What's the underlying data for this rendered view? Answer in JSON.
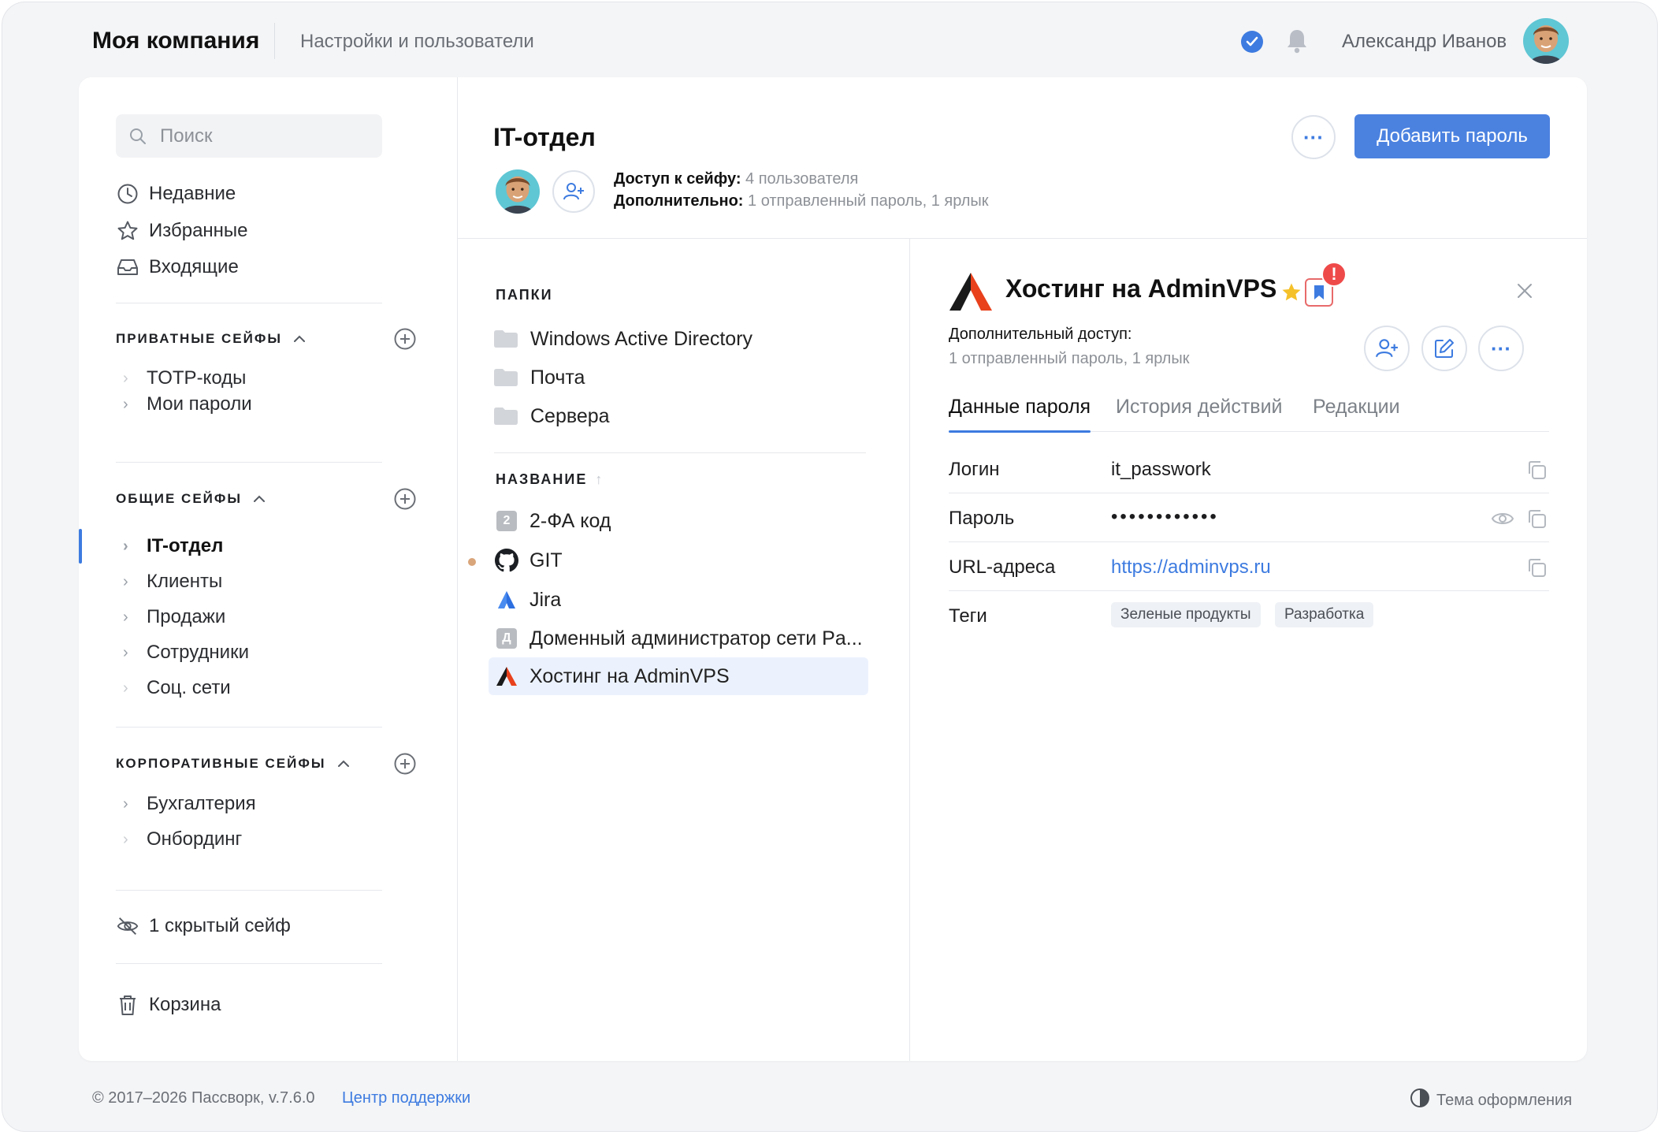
{
  "header": {
    "brand": "Моя компания",
    "nav_link": "Настройки и пользователи",
    "user_name": "Александр Иванов"
  },
  "sidebar": {
    "search_placeholder": "Поиск",
    "quick": [
      {
        "label": "Недавние",
        "icon": "clock-icon"
      },
      {
        "label": "Избранные",
        "icon": "star-icon"
      },
      {
        "label": "Входящие",
        "icon": "inbox-icon"
      }
    ],
    "sections": [
      {
        "title": "ПРИВАТНЫЕ СЕЙФЫ",
        "items": [
          "TOTP-коды",
          "Мои пароли"
        ]
      },
      {
        "title": "ОБЩИЕ СЕЙФЫ",
        "items": [
          "IT-отдел",
          "Клиенты",
          "Продажи",
          "Сотрудники",
          "Соц. сети"
        ]
      },
      {
        "title": "КОРПОРАТИВНЫЕ СЕЙФЫ",
        "items": [
          "Бухгалтерия",
          "Онбординг"
        ]
      }
    ],
    "hidden_vaults": "1 скрытый сейф",
    "trash": "Корзина"
  },
  "vault": {
    "title": "IT-отдел",
    "access_label": "Доступ к сейфу:",
    "access_value": "4 пользователя",
    "extra_label": "Дополнительно:",
    "extra_value": "1 отправленный пароль, 1 ярлык",
    "more_label": "···",
    "add_button": "Добавить пароль"
  },
  "list": {
    "folders_header": "ПАПКИ",
    "folders": [
      "Windows Active Directory",
      "Почта",
      "Сервера"
    ],
    "name_header": "НАЗВАНИЕ",
    "sort_arrow": "↑",
    "items": [
      {
        "name": "2-ФА код",
        "icon_letter": "2"
      },
      {
        "name": "GIT",
        "icon": "github-icon"
      },
      {
        "name": "Jira",
        "icon": "jira-icon"
      },
      {
        "name": "Доменный администратор сети Pa...",
        "icon_letter": "Д"
      },
      {
        "name": "Хостинг на AdminVPS",
        "icon": "adminvps-icon"
      }
    ]
  },
  "detail": {
    "title": "Хостинг на AdminVPS",
    "alert": "!",
    "extra_label": "Дополнительный доступ:",
    "extra_value": "1 отправленный пароль, 1 ярлык",
    "more_label": "···",
    "tabs": [
      "Данные пароля",
      "История действий",
      "Редакции"
    ],
    "fields": {
      "login_label": "Логин",
      "login_value": "it_passwork",
      "password_label": "Пароль",
      "password_value": "••••••••••••",
      "url_label": "URL-адреса",
      "url_value": "https://adminvps.ru",
      "tags_label": "Теги",
      "tags": [
        "Зеленые продукты",
        "Разработка"
      ]
    }
  },
  "footer": {
    "copyright": "© 2017–2026 Пассворк, v.7.6.0",
    "support": "Центр поддержки",
    "theme": "Тема оформления"
  },
  "colors": {
    "accent": "#3d7be0",
    "primary_button": "#4b82e0",
    "alert": "#ef4a4a",
    "selected_row": "#ecf2fd"
  }
}
